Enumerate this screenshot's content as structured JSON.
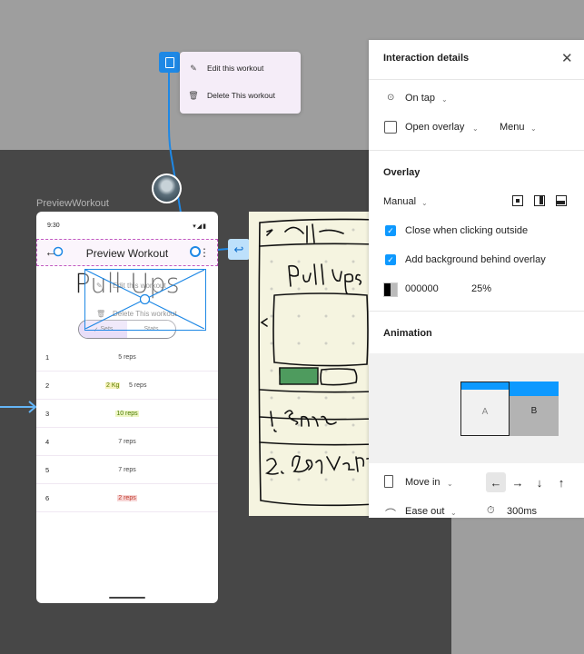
{
  "overlay_menu": {
    "items": [
      {
        "label": "Edit this workout",
        "icon": "pencil-icon"
      },
      {
        "label": "Delete This workout",
        "icon": "trash-icon"
      }
    ]
  },
  "frame": {
    "label": "PreviewWorkout",
    "status_time": "9:30",
    "appbar_title": "Preview Workout",
    "big_title": "Pull Ups",
    "tabs": [
      "Sets",
      "Stats"
    ],
    "rows": [
      {
        "n": "1",
        "reps": "5 reps"
      },
      {
        "n": "2",
        "kg": "2 Kg",
        "reps": "5 reps"
      },
      {
        "n": "3",
        "reps": "10 reps",
        "style": "green"
      },
      {
        "n": "4",
        "reps": "7 reps"
      },
      {
        "n": "5",
        "reps": "7 reps"
      },
      {
        "n": "6",
        "reps": "2 reps",
        "style": "red"
      }
    ],
    "ghost_items": [
      "Edit this workout",
      "Delete This workout"
    ]
  },
  "panel": {
    "title": "Interaction details",
    "trigger": "On tap",
    "action": "Open overlay",
    "destination": "Menu",
    "overlay_heading": "Overlay",
    "position": "Manual",
    "close_outside": "Close when clicking outside",
    "add_background": "Add background behind overlay",
    "bg_color": "000000",
    "bg_opacity": "25%",
    "animation_heading": "Animation",
    "box_a": "A",
    "box_b": "B",
    "animation_type": "Move in",
    "easing": "Ease out",
    "duration": "300ms"
  },
  "colors": {
    "accent": "#0d99ff",
    "canvas_dark": "#474747",
    "canvas_light": "#9e9e9e"
  }
}
